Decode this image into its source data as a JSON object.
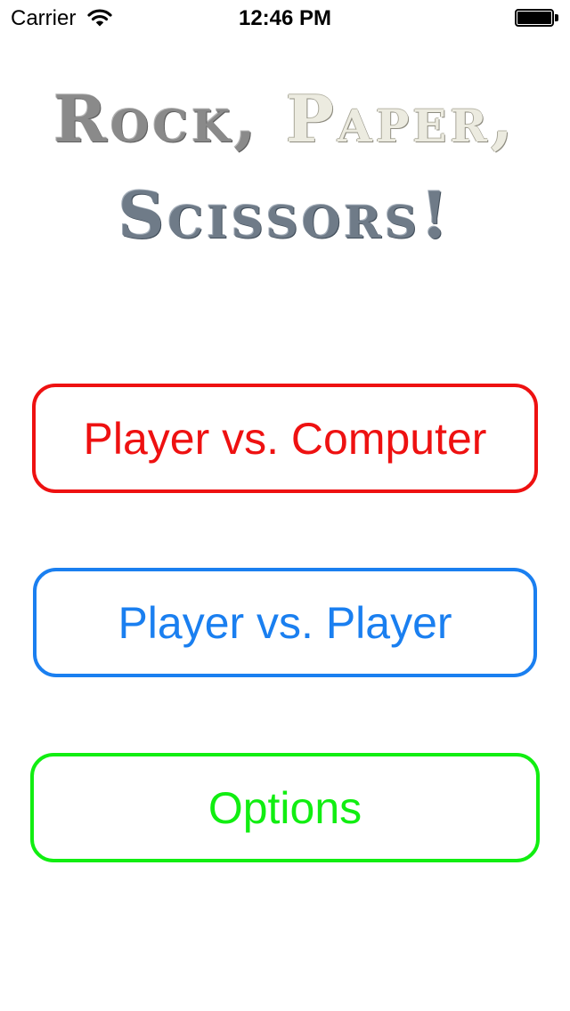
{
  "status_bar": {
    "carrier": "Carrier",
    "time": "12:46 PM",
    "wifi_icon": "wifi-icon",
    "battery_icon": "battery-full-icon"
  },
  "title": {
    "word_rock": "Rock,",
    "word_paper": "Paper,",
    "word_scissors": "Scissors!",
    "colors": {
      "rock": "#8a8a8a",
      "paper": "#ecebe0",
      "scissors": "#6f7b88"
    }
  },
  "menu": {
    "player_vs_computer": {
      "label": "Player vs. Computer",
      "color": "#ee1111"
    },
    "player_vs_player": {
      "label": "Player vs. Player",
      "color": "#1a7ff0"
    },
    "options": {
      "label": "Options",
      "color": "#11ee11"
    }
  }
}
